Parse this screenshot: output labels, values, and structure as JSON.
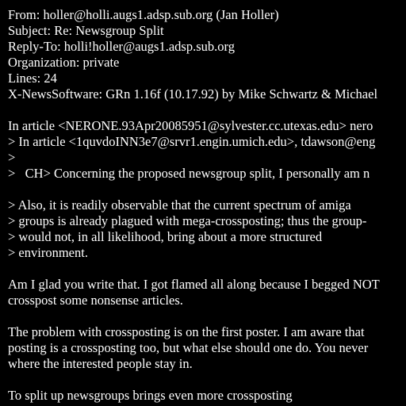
{
  "colors": {
    "background": "#000000",
    "text": "#ffffff"
  },
  "headers": {
    "from": "From: holler@holli.augs1.adsp.sub.org (Jan Holler)",
    "subject": "Subject: Re: Newsgroup Split",
    "reply_to": "Reply-To: holli!holler@augs1.adsp.sub.org",
    "organization": "Organization: private",
    "lines": "Lines: 24",
    "x_newssoftware": "X-NewsSoftware: GRn 1.16f (10.17.92) by Mike Schwartz & Michael"
  },
  "quote": {
    "attribution": "In article <NERONE.93Apr20085951@sylvester.cc.utexas.edu> nero",
    "nested_attribution": "> In article <1quvdoINN3e7@srvr1.engin.umich.edu>, tdawson@eng",
    "nested_blank": ">",
    "ch_line": ">   CH> Concerning the proposed newsgroup split, I personally am n",
    "q1": "> Also, it is readily observable that the current spectrum of amiga",
    "q2": "> groups is already plagued with mega-crossposting; thus the group-",
    "q3": "> would not, in all likelihood, bring about a more structured",
    "q4": "> environment."
  },
  "body": {
    "p1_l1": "Am I glad you write that. I got flamed all along because I begged NOT",
    "p1_l2": "crosspost some nonsense articles.",
    "p2_l1": "The problem with crossposting is on the first poster. I am aware that",
    "p2_l2": "posting is a crossposting too, but what else should one do. You never",
    "p2_l3": "where the interested people stay in.",
    "p3_l1": "To split up newsgroups brings even more crossposting"
  }
}
